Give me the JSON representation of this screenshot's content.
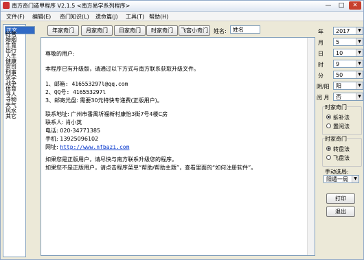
{
  "window": {
    "title": "南方奇门遁甲程序 V2.1.5    <南方易学系列程序>",
    "min": "—",
    "max": "□",
    "close": "✕"
  },
  "menu": [
    "文件(F)",
    "编辑(E)",
    "奇门知识(L)",
    "遗命篇(J)",
    "工具(T)",
    "帮助(H)"
  ],
  "categories": [
    "正文",
    "经营",
    "婚姻",
    "生育",
    "出行",
    "人生",
    "健康",
    "官司",
    "刑事",
    "求学",
    "战争",
    "体育",
    "寻人",
    "寻物",
    "天气",
    "风水",
    "其它"
  ],
  "toolbar": {
    "buttons": [
      "年家奇门",
      "月家奇门",
      "日家奇门",
      "时家奇门",
      "飞宫小奇门"
    ],
    "name_label": "姓名:",
    "name_value": "姓名"
  },
  "content": {
    "lines": [
      "尊敬的用户:",
      "本程序已有升级版，请通过以下方式与南方联系获取升级文件。",
      "1、邮箱: 416553297l@qq.com",
      "2、QQ号: 416553297l",
      "3、邮寄光盘: 需要30元特快专递费(正版用户)。",
      "联系地址: 广州市番禺圻福新村康怡3街7号4楼C房",
      "联系人: 肖小英",
      "电话: 020-34771385",
      "手机: 13925096102",
      "网址: ",
      "如果您是正版用户，请尽快与南方联系升级您的程序。",
      "如果您不是正版用户，请点击程序菜单“帮助/帮助主题”，查看里面的“如何注册软件”。"
    ],
    "url": "http://www.nfbazi.com"
  },
  "right": {
    "fields": [
      {
        "label": "年",
        "value": "2017"
      },
      {
        "label": "月",
        "value": "5"
      },
      {
        "label": "日",
        "value": "10"
      },
      {
        "label": "时",
        "value": "9"
      },
      {
        "label": "分",
        "value": "50"
      },
      {
        "label": "阴/阳",
        "value": "阳"
      },
      {
        "label": "闰 月",
        "value": "否"
      }
    ],
    "group1": {
      "title": "时家奇门",
      "options": [
        "拆补法",
        "置闰法"
      ],
      "selected": 0
    },
    "group2": {
      "title": "时家奇门",
      "options": [
        "转盘法",
        "飞盘法"
      ],
      "selected": 0
    },
    "manual_label": "手动选局:",
    "manual_value": "阳遁一局",
    "print": "打印",
    "exit": "退出"
  }
}
